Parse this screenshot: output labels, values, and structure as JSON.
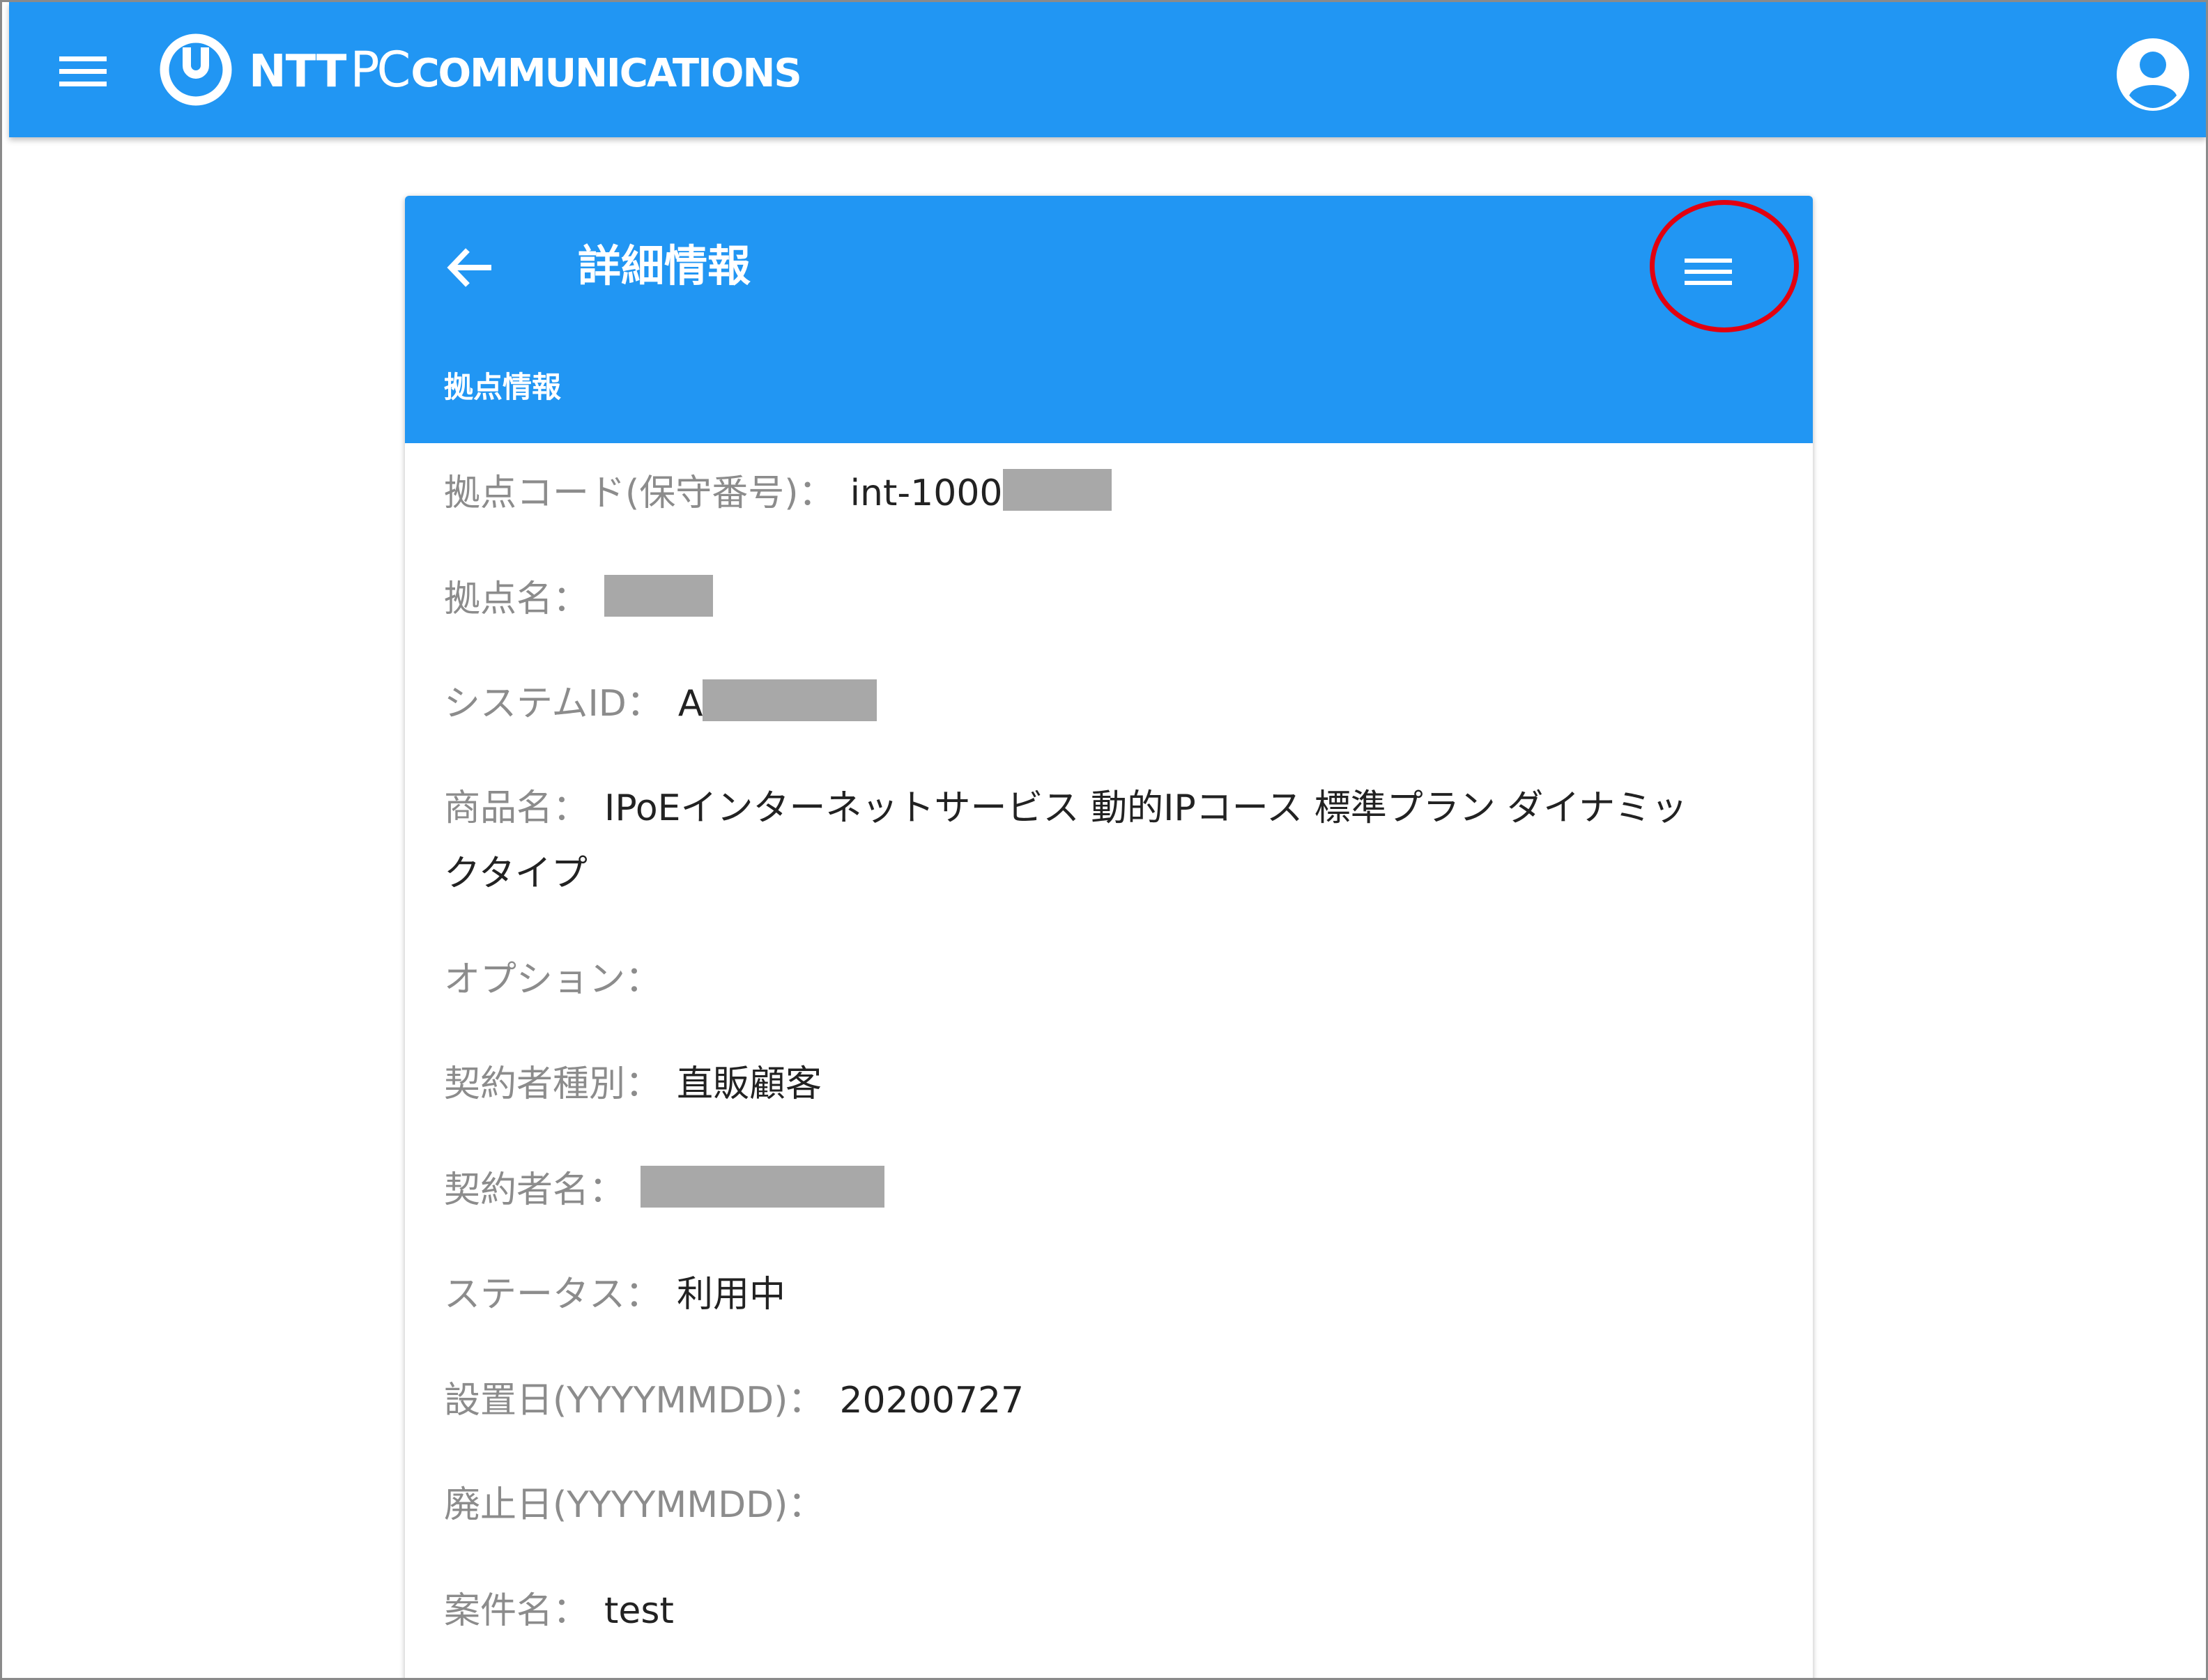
{
  "appbar": {
    "brand_main": "NTT",
    "brand_pc": "PC",
    "brand_rest": "COMMUNICATIONS",
    "menu_icon": "menu-icon",
    "account_icon": "account-circle-icon",
    "color": "#2196f3"
  },
  "card": {
    "title": "詳細情報",
    "subtitle": "拠点情報",
    "back_icon": "arrow-left-icon",
    "menu_icon": "menu-icon",
    "highlight_color": "#e3000f"
  },
  "fields": [
    {
      "label": "拠点コード(保守番号)",
      "sep": "：",
      "value": "int-1000",
      "redacted": true
    },
    {
      "label": "拠点名",
      "sep": "：",
      "value": "",
      "redacted": true
    },
    {
      "label": "システムID",
      "sep": "：",
      "value": "A",
      "redacted": true
    },
    {
      "label": "商品名",
      "sep": "：",
      "value_line1": "IPoEインターネットサービス 動的IPコース 標準プラン ダイナミッ",
      "value_line2": "クタイプ"
    },
    {
      "label": "オプション",
      "sep": "：",
      "value": ""
    },
    {
      "label": "契約者種別",
      "sep": "：",
      "value": "直販顧客"
    },
    {
      "label": "契約者名",
      "sep": "：",
      "value": "",
      "redacted": true
    },
    {
      "label": "ステータス",
      "sep": "：",
      "value": "利用中"
    },
    {
      "label": "設置日(YYYYMMDD)",
      "sep": "：",
      "value": "20200727"
    },
    {
      "label": "廃止日(YYYYMMDD)",
      "sep": "：",
      "value": ""
    },
    {
      "label": "案件名",
      "sep": "：",
      "value": "test"
    }
  ]
}
